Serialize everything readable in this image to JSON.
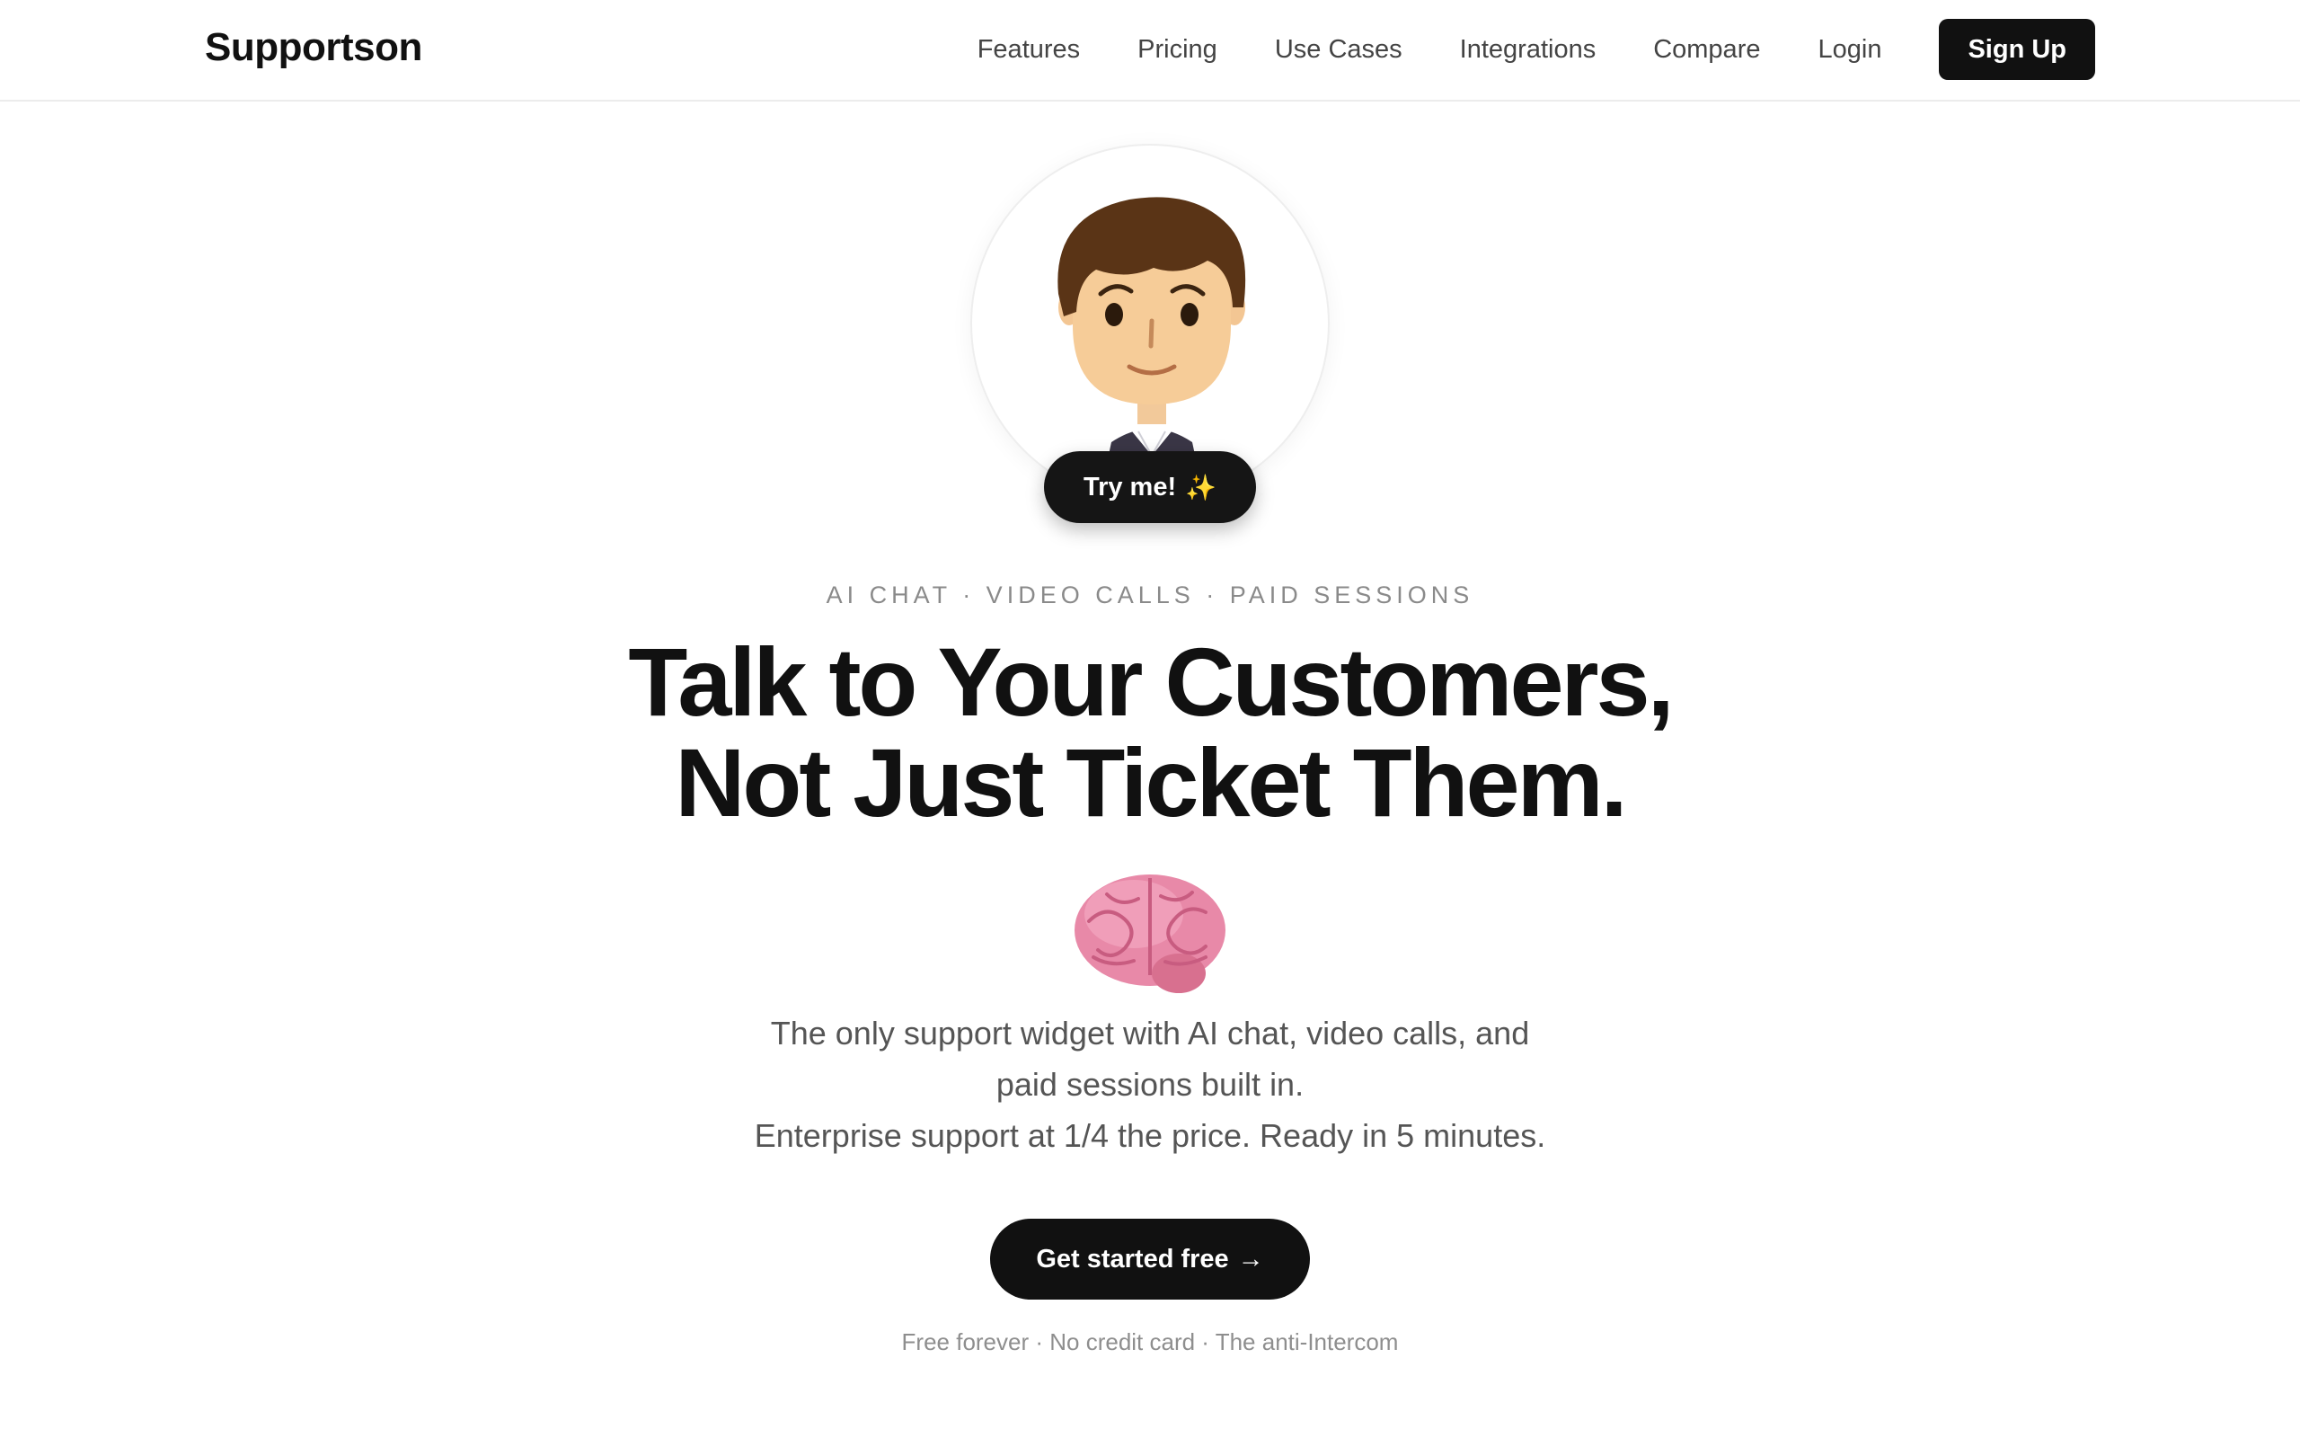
{
  "header": {
    "brand": "Supportson",
    "nav": [
      {
        "label": "Features"
      },
      {
        "label": "Pricing"
      },
      {
        "label": "Use Cases"
      },
      {
        "label": "Integrations"
      },
      {
        "label": "Compare"
      },
      {
        "label": "Login"
      }
    ],
    "signup_label": "Sign Up"
  },
  "hero": {
    "avatar_icon": "cartoon-support-agent-avatar",
    "tryme_label": "Try me!",
    "tryme_icon": "sparkles-emoji",
    "eyebrow": "AI CHAT · VIDEO CALLS · PAID SESSIONS",
    "headline_line1": "Talk to Your Customers,",
    "headline_line2": "Not Just Ticket Them.",
    "brain_icon": "brain-emoji",
    "subcopy_line1": "The only support widget with AI chat, video calls, and",
    "subcopy_line2": "paid sessions built in.",
    "subcopy_line3": "Enterprise support at 1/4 the price. Ready in 5 minutes.",
    "cta_label": "Get started free",
    "cta_arrow": "→",
    "fineprint": "Free forever · No credit card · The anti-Intercom"
  },
  "colors": {
    "primary": "#111111",
    "text_muted": "#555555",
    "eyebrow": "#8a8a8a",
    "border": "#ececec",
    "sparkle": "#f5c518",
    "brain": "#e889a8"
  }
}
